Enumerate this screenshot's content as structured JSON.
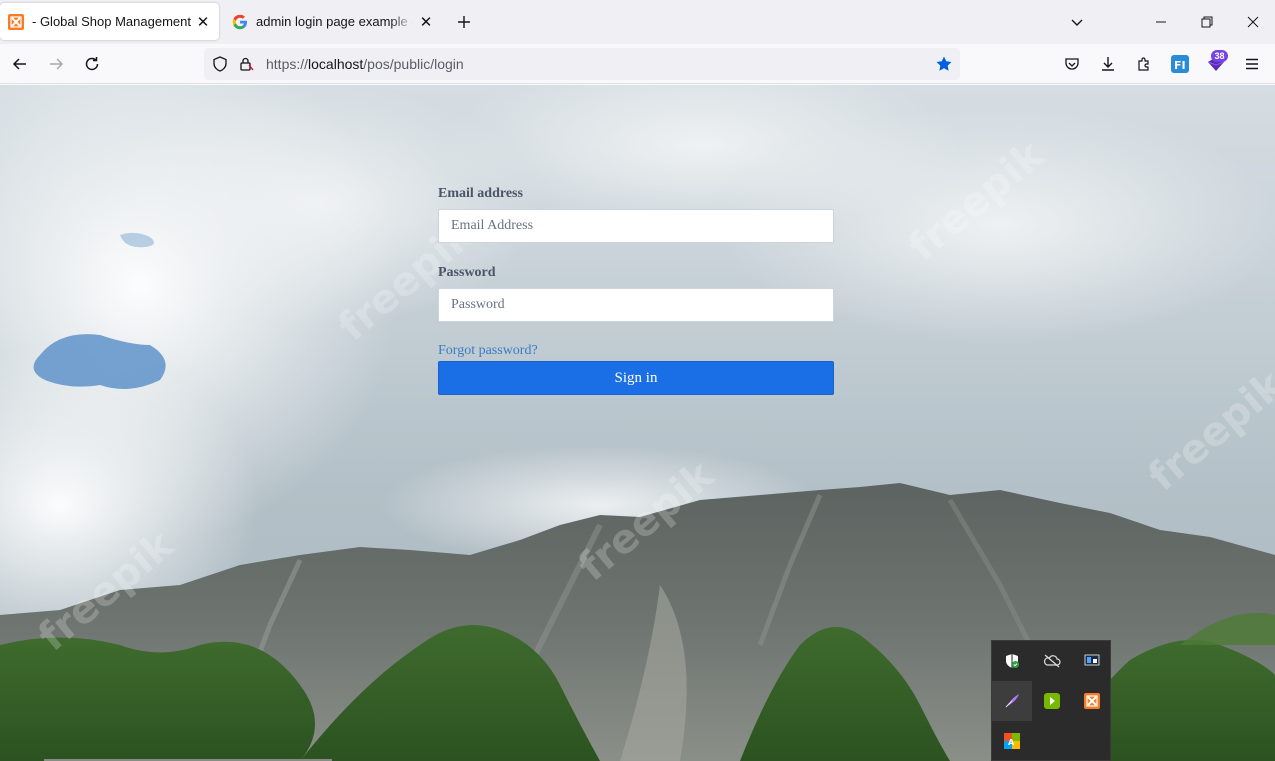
{
  "browser": {
    "tabs": [
      {
        "title": "- Global Shop Management",
        "active": true
      },
      {
        "title": "admin login page example - Google Search",
        "active": false
      }
    ],
    "url": {
      "scheme": "https://",
      "host": "localhost",
      "path": "/pos/public/login"
    },
    "extension_badge": "38"
  },
  "login": {
    "email_label": "Email address",
    "email_placeholder": "Email Address",
    "password_label": "Password",
    "password_placeholder": "Password",
    "forgot_link": "Forgot password?",
    "signin_button": "Sign in"
  },
  "background": {
    "watermark_text": "freepik"
  },
  "colors": {
    "primary_button": "#1a6fe6",
    "link": "#3a7cc6",
    "label": "#4a5568"
  },
  "system_tray": {
    "icons": [
      "windows-security-icon",
      "onedrive-icon",
      "network-monitor-icon",
      "pen-feather-icon",
      "nvidia-icon",
      "xampp-icon",
      "color-grid-icon"
    ]
  }
}
